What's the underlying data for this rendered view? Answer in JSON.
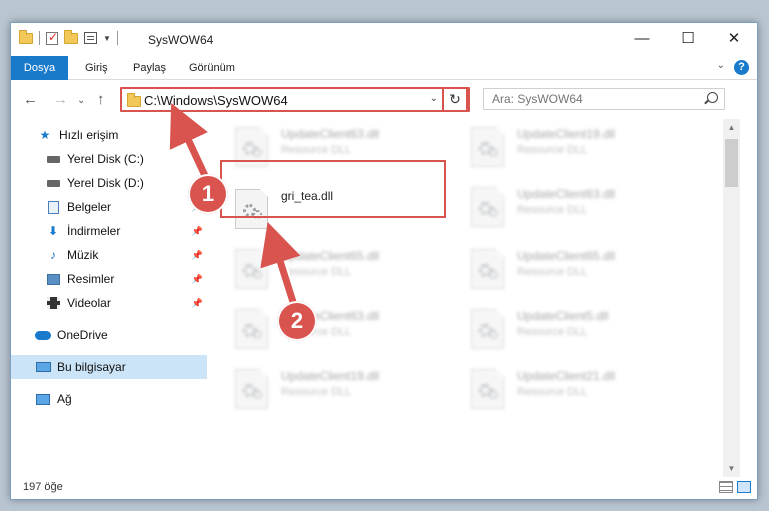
{
  "window": {
    "title": "SysWOW64",
    "controls": {
      "minimize": "—",
      "maximize": "☐",
      "close": "✕"
    }
  },
  "ribbon": {
    "tabs": [
      "Dosya",
      "Giriş",
      "Paylaş",
      "Görünüm"
    ]
  },
  "address": {
    "path": "C:\\Windows\\SysWOW64",
    "search_placeholder": "Ara: SysWOW64"
  },
  "sidebar": {
    "items": [
      {
        "label": "Hızlı erişim",
        "icon": "star-icon"
      },
      {
        "label": "Yerel Disk (C:)",
        "icon": "drive-icon"
      },
      {
        "label": "Yerel Disk (D:)",
        "icon": "drive-icon"
      },
      {
        "label": "Belgeler",
        "icon": "documents-icon"
      },
      {
        "label": "İndirmeler",
        "icon": "downloads-icon"
      },
      {
        "label": "Müzik",
        "icon": "music-icon"
      },
      {
        "label": "Resimler",
        "icon": "pictures-icon"
      },
      {
        "label": "Videolar",
        "icon": "videos-icon"
      },
      {
        "label": "OneDrive",
        "icon": "cloud-icon"
      },
      {
        "label": "Bu bilgisayar",
        "icon": "computer-icon"
      },
      {
        "label": "Ağ",
        "icon": "network-icon"
      }
    ]
  },
  "files": {
    "left": [
      {
        "name": "UpdateClient63.dll",
        "type": "Resource DLL"
      },
      {
        "name": "gri_tea.dll",
        "type": ""
      },
      {
        "name": "UpdateClient65.dll",
        "type": "Resource DLL"
      },
      {
        "name": "UpdateClient63.dll",
        "type": "Resource DLL"
      },
      {
        "name": "UpdateClient19.dll",
        "type": "Resource DLL"
      }
    ],
    "right": [
      {
        "name": "UpdateClient19.dll",
        "type": "Resource DLL"
      },
      {
        "name": "UpdateClient63.dll",
        "type": "Resource DLL"
      },
      {
        "name": "UpdateClient65.dll",
        "type": "Resource DLL"
      },
      {
        "name": "UpdateClient5.dll",
        "type": "Resource DLL"
      },
      {
        "name": "UpdateClient21.dll",
        "type": "Resource DLL"
      }
    ]
  },
  "status": {
    "count": "197 öğe"
  },
  "callouts": {
    "step1": "1",
    "step2": "2"
  },
  "colors": {
    "accent": "#1979ca",
    "callout": "#d9534f"
  }
}
